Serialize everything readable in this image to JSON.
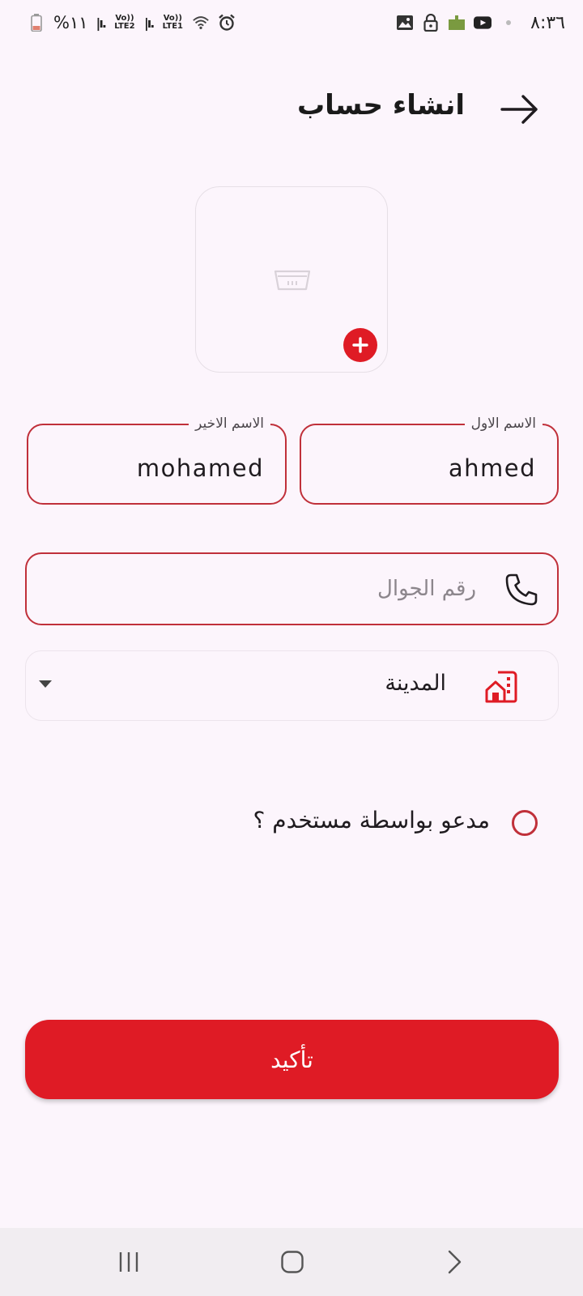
{
  "status_bar": {
    "battery_text": "%١١",
    "sim1_label": "Vo)) LTE2",
    "sim2_label": "Vo)) LTE1",
    "time": "٨:٣٦"
  },
  "header": {
    "title": "انشاء حساب",
    "back_icon": "arrow-right-icon"
  },
  "image_picker": {
    "icon": "basket-icon",
    "add_icon": "plus-icon",
    "accent": "#df1b25"
  },
  "form": {
    "first_name": {
      "label": "الاسم الاول",
      "value": "ahmed"
    },
    "last_name": {
      "label": "الاسم الاخير",
      "value": "mohamed"
    },
    "phone": {
      "placeholder": "رقم الجوال",
      "icon": "phone-icon"
    },
    "city": {
      "value": "المدينة",
      "icon": "city-buildings-icon"
    },
    "invited": {
      "label": "مدعو بواسطة مستخدم ؟",
      "checked": false
    }
  },
  "confirm_button": {
    "label": "تأكيد"
  },
  "colors": {
    "background": "#fcf5fc",
    "primary": "#df1b25",
    "border": "#c0303a"
  }
}
